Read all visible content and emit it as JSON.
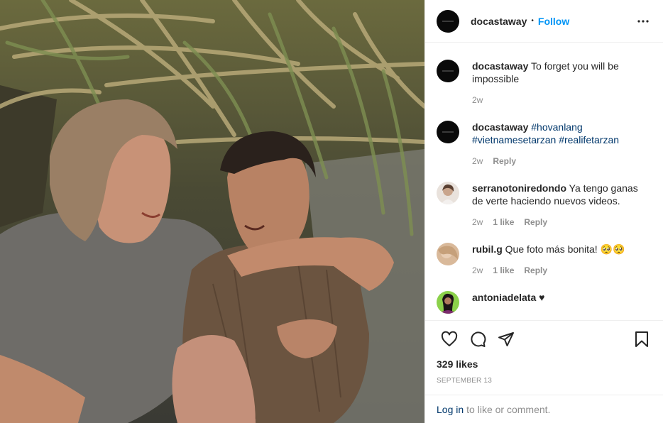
{
  "post": {
    "username": "docastaway",
    "follow_label": "Follow",
    "separator": "•"
  },
  "comments": [
    {
      "user": "docastaway",
      "text": " To forget you will be impossible",
      "time": "2w",
      "likes": "",
      "reply": ""
    },
    {
      "user": "docastaway",
      "tags": [
        "#hovanlang",
        "#vietnamesetarzan",
        "#realifetarzan"
      ],
      "time": "2w",
      "likes": "",
      "reply": "Reply"
    },
    {
      "user": "serranotoniredondo",
      "text": " Ya tengo ganas de verte haciendo nuevos videos.",
      "time": "2w",
      "likes": "1 like",
      "reply": "Reply"
    },
    {
      "user": "rubil.g",
      "text": " Que foto más bonita! 🥺🥺",
      "time": "2w",
      "likes": "1 like",
      "reply": "Reply"
    },
    {
      "user": "antoniadelata",
      "text": " ♥",
      "time": "",
      "likes": "",
      "reply": ""
    }
  ],
  "likes_text": "329 likes",
  "date_text": "SEPTEMBER 13",
  "login": {
    "link": "Log in",
    "rest": "to like or comment."
  },
  "icons": [
    "more-icon",
    "heart-icon",
    "comment-icon",
    "share-icon",
    "bookmark-icon"
  ],
  "colors": {
    "follow": "#0095f6",
    "hashtag": "#00376b",
    "muted": "#8e8e8e",
    "border": "#efefef"
  }
}
